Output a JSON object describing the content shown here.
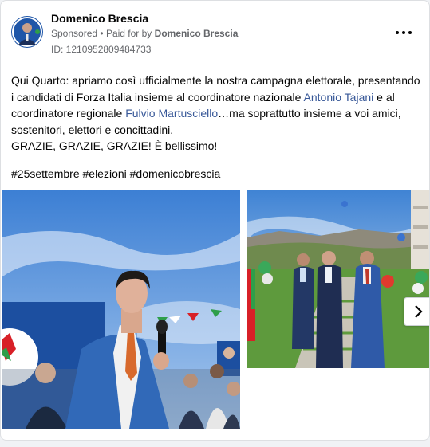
{
  "post": {
    "author": "Domenico Brescia",
    "sponsored": "Sponsored",
    "separator": "•",
    "paid_for_prefix": "Paid for by",
    "paid_for_by": "Domenico Brescia",
    "ad_id": "ID: 1210952809484733",
    "text_part1": "Qui Quarto: apriamo così ufficialmente la nostra campagna elettorale, presentando i candidati di Forza Italia insieme al coordinatore nazionale ",
    "link1": "Antonio Tajani",
    "text_part2": " e al coordinatore regionale ",
    "link2": "Fulvio Martusciello",
    "text_part3": "…ma soprattutto insieme a voi amici, sostenitori, elettori e concittadini.",
    "line2": "GRAZIE, GRAZIE, GRAZIE! È bellissimo!",
    "hashtags": "#25settembre #elezioni #domenicobrescia"
  },
  "icons": {
    "more": "more-options-icon",
    "next": "chevron-right-icon"
  },
  "colors": {
    "link": "#385898",
    "text": "#050505",
    "meta": "#65676b",
    "party_blue": "#1c4fa0"
  }
}
